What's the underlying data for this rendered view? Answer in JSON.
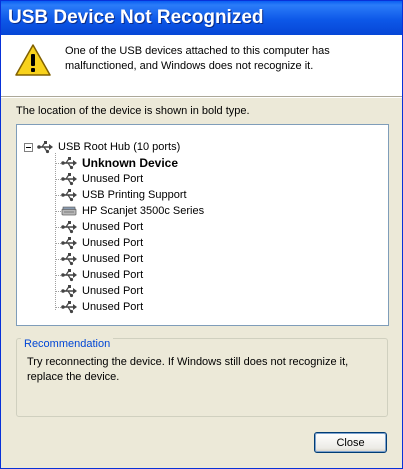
{
  "window": {
    "title": "USB Device Not Recognized"
  },
  "header": {
    "icon": "warning-icon",
    "message": "One of the USB devices attached to this computer has malfunctioned, and Windows does not recognize it."
  },
  "location_text": "The location of the device is shown in bold type.",
  "tree": {
    "root": {
      "label": "USB Root Hub (10 ports)",
      "icon": "usb-icon",
      "expanded": true
    },
    "children": [
      {
        "label": "Unknown Device",
        "icon": "usb-icon",
        "bold": true
      },
      {
        "label": "Unused Port",
        "icon": "usb-icon"
      },
      {
        "label": "USB Printing Support",
        "icon": "usb-icon"
      },
      {
        "label": "HP Scanjet 3500c Series",
        "icon": "scanner-icon"
      },
      {
        "label": "Unused Port",
        "icon": "usb-icon"
      },
      {
        "label": "Unused Port",
        "icon": "usb-icon"
      },
      {
        "label": "Unused Port",
        "icon": "usb-icon"
      },
      {
        "label": "Unused Port",
        "icon": "usb-icon"
      },
      {
        "label": "Unused Port",
        "icon": "usb-icon"
      },
      {
        "label": "Unused Port",
        "icon": "usb-icon"
      }
    ]
  },
  "recommendation": {
    "title": "Recommendation",
    "text": "Try reconnecting the device. If Windows still does not recognize it, replace the device."
  },
  "buttons": {
    "close": "Close"
  },
  "colors": {
    "titlebar": "#0a5ff2",
    "accent": "#0046d5",
    "dialog_bg": "#ece9d8"
  }
}
